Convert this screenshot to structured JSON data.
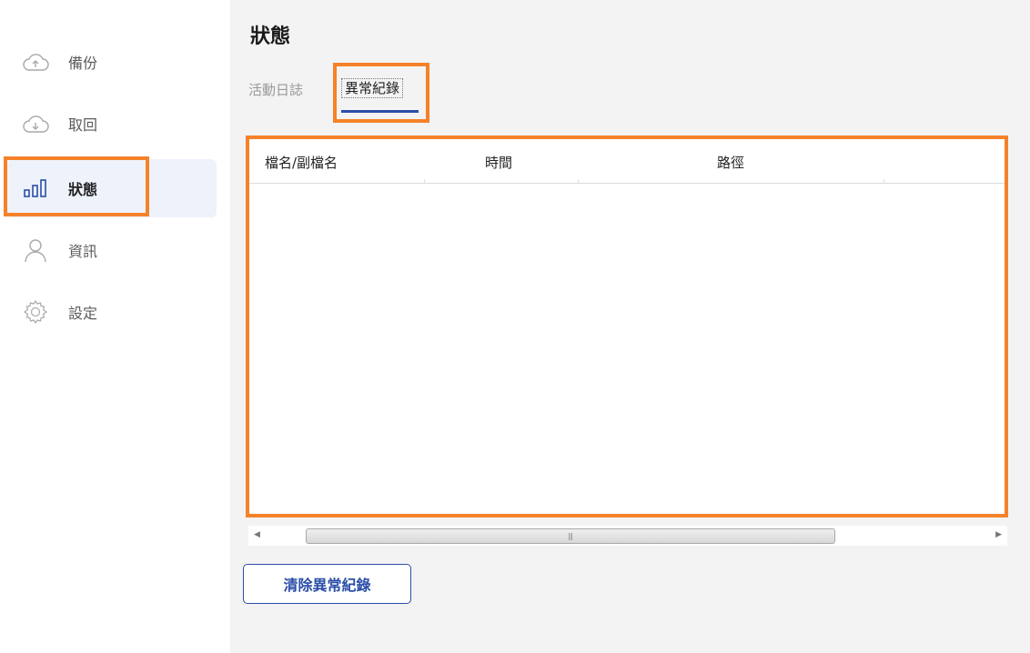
{
  "sidebar": {
    "items": [
      {
        "label": "備份",
        "icon": "cloud-upload-icon"
      },
      {
        "label": "取回",
        "icon": "cloud-download-icon"
      },
      {
        "label": "狀態",
        "icon": "status-bars-icon"
      },
      {
        "label": "資訊",
        "icon": "user-icon"
      },
      {
        "label": "設定",
        "icon": "gear-icon"
      }
    ],
    "active_index": 2
  },
  "main": {
    "title": "狀態",
    "tabs": [
      {
        "label": "活動日誌"
      },
      {
        "label": "異常紀錄"
      }
    ],
    "active_tab": 1,
    "table": {
      "columns": [
        "檔名/副檔名",
        "時間",
        "路徑"
      ],
      "rows": []
    },
    "clear_button": "清除異常紀錄"
  },
  "colors": {
    "accent": "#2a4ea8",
    "highlight": "#f5822a",
    "active_nav_bg": "#eef2fb",
    "main_bg": "#f3f3f3"
  }
}
